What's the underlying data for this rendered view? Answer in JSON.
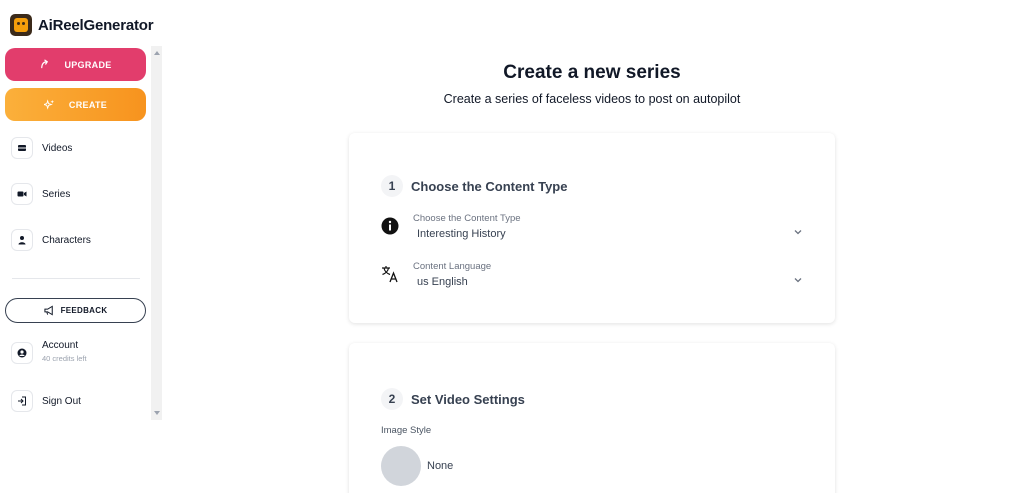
{
  "brand": {
    "name": "AiReelGenerator"
  },
  "sidebar": {
    "upgrade_label": "UPGRADE",
    "create_label": "CREATE",
    "items": [
      {
        "label": "Videos",
        "icon": "video-list-icon"
      },
      {
        "label": "Series",
        "icon": "camera-icon"
      },
      {
        "label": "Characters",
        "icon": "person-icon"
      }
    ],
    "feedback_label": "FEEDBACK",
    "account": {
      "label": "Account",
      "credits": "40 credits left"
    },
    "signout_label": "Sign Out"
  },
  "main": {
    "title": "Create a new series",
    "subtitle": "Create a series of faceless videos to post on autopilot",
    "step1": {
      "number": "1",
      "title": "Choose the Content Type",
      "content_type": {
        "label": "Choose the Content Type",
        "value": "Interesting History"
      },
      "language": {
        "label": "Content Language",
        "value": "us English"
      }
    },
    "step2": {
      "number": "2",
      "title": "Set Video Settings",
      "image_style_label": "Image Style",
      "image_style_option": "None"
    }
  },
  "colors": {
    "upgrade": "#e23d6c",
    "create": "#f7931e",
    "text": "#111827"
  }
}
